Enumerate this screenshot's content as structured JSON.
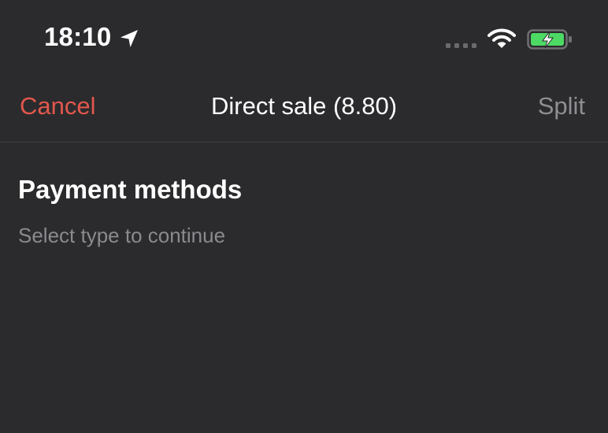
{
  "status_bar": {
    "time": "18:10",
    "icons": [
      "location-arrow-icon",
      "cellular-signal-icon",
      "wifi-icon",
      "battery-charging-icon"
    ],
    "battery_color": "#4cd964"
  },
  "nav": {
    "cancel_label": "Cancel",
    "title": "Direct sale (8.80)",
    "split_label": "Split"
  },
  "content": {
    "section_title": "Payment methods",
    "subtitle": "Select type to continue"
  },
  "colors": {
    "background": "#2b2b2d",
    "cancel": "#e2574c",
    "split_disabled": "#8e8e93",
    "subtitle": "#8a8a8f"
  }
}
